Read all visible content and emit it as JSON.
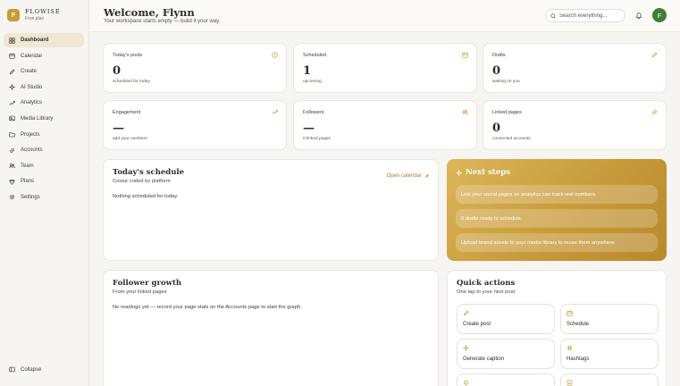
{
  "brand": {
    "initial": "F",
    "name": "FLOWISE",
    "plan": "Free plan"
  },
  "sidebar": {
    "items": [
      {
        "label": "Dashboard",
        "icon": "grid-icon",
        "active": true
      },
      {
        "label": "Calendar",
        "icon": "calendar-icon"
      },
      {
        "label": "Create",
        "icon": "pencil-icon"
      },
      {
        "label": "AI Studio",
        "icon": "sparkle-icon"
      },
      {
        "label": "Analytics",
        "icon": "trend-icon"
      },
      {
        "label": "Media Library",
        "icon": "image-icon"
      },
      {
        "label": "Projects",
        "icon": "folder-icon"
      },
      {
        "label": "Accounts",
        "icon": "link-icon"
      },
      {
        "label": "Team",
        "icon": "users-icon"
      },
      {
        "label": "Plans",
        "icon": "diamond-icon"
      },
      {
        "label": "Settings",
        "icon": "gear-icon"
      }
    ],
    "collapse_label": "Collapse"
  },
  "header": {
    "title": "Welcome, Flynn",
    "subtitle": "Your workspace starts empty — build it your way.",
    "search_placeholder": "Search everything...",
    "avatar_initial": "F"
  },
  "stats": [
    {
      "label": "Today's posts",
      "value": "0",
      "sub": "scheduled for today",
      "icon": "clock-icon"
    },
    {
      "label": "Scheduled",
      "value": "1",
      "sub": "upcoming",
      "icon": "calendar-icon"
    },
    {
      "label": "Drafts",
      "value": "0",
      "sub": "waiting on you",
      "icon": "pencil-icon"
    },
    {
      "label": "Engagement",
      "value": "—",
      "sub": "add your numbers",
      "icon": "trend-icon"
    },
    {
      "label": "Followers",
      "value": "—",
      "sub": "0 linked pages",
      "icon": "users-icon"
    },
    {
      "label": "Linked pages",
      "value": "0",
      "sub": "connected accounts",
      "icon": "link-icon"
    }
  ],
  "schedule": {
    "title": "Today's schedule",
    "subtitle": "Colour coded by platform",
    "empty": "Nothing scheduled for today.",
    "open_calendar": "Open calendar"
  },
  "next_steps": {
    "title": "Next steps",
    "items": [
      "Link your social pages so analytics can track real numbers.",
      "0 drafts ready to schedule.",
      "Upload brand assets to your media library to reuse them anywhere."
    ]
  },
  "follower_growth": {
    "title": "Follower growth",
    "subtitle": "From your linked pages",
    "empty": "No readings yet — record your page stats on the Accounts page to start the graph."
  },
  "quick_actions": {
    "title": "Quick actions",
    "subtitle": "One tap to your next post",
    "buttons": [
      {
        "label": "Create post",
        "icon": "pencil-icon"
      },
      {
        "label": "Schedule",
        "icon": "calendar-icon"
      },
      {
        "label": "Generate caption",
        "icon": "sparkle-icon"
      },
      {
        "label": "Hashtags",
        "icon": "hash-icon"
      },
      {
        "label": "",
        "icon": "bulb-icon"
      },
      {
        "label": "",
        "icon": "chart-icon"
      }
    ]
  },
  "colors": {
    "accent": "#c79a3a",
    "avatar": "#3f7d3a",
    "background": "#f7f5f1"
  }
}
